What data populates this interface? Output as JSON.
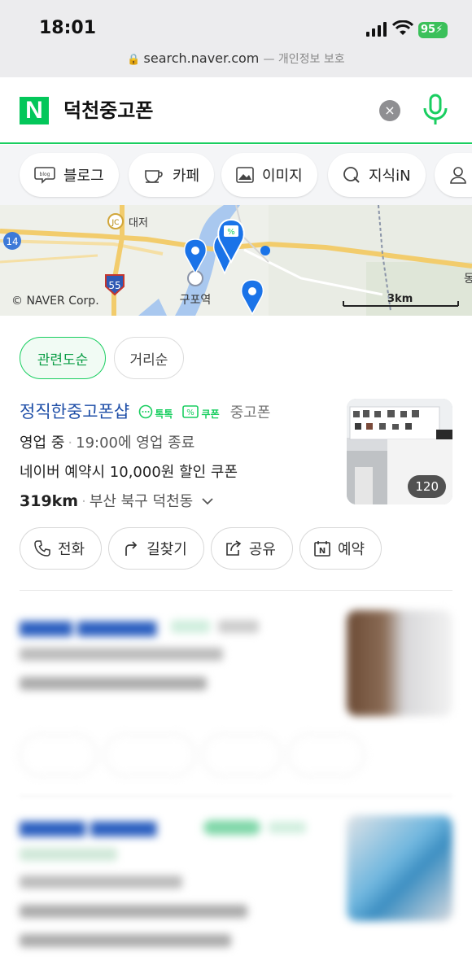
{
  "status_bar": {
    "time": "18:01",
    "battery": "95"
  },
  "address_bar": {
    "domain": "search.naver.com",
    "suffix": "— 개인정보 보호"
  },
  "search": {
    "logo": "N",
    "query": "덕천중고폰"
  },
  "categories": [
    {
      "label": "블로그",
      "icon": "blog-icon"
    },
    {
      "label": "카페",
      "icon": "cafe-cup-icon"
    },
    {
      "label": "이미지",
      "icon": "image-icon"
    },
    {
      "label": "지식iN",
      "icon": "kin-icon"
    },
    {
      "label": "",
      "icon": "person-icon"
    }
  ],
  "map": {
    "copyright": "© NAVER Corp.",
    "scale": "3km",
    "labels": {
      "jc": "JC",
      "daejeo": "대저",
      "gupo": "구포역",
      "route14": "14",
      "route55": "55",
      "edge": "동"
    }
  },
  "sort": {
    "active": "관련도순",
    "other": "거리순"
  },
  "results": [
    {
      "name": "정직한중고폰샵",
      "talk_tag": "톡톡",
      "coupon_tag": "쿠폰",
      "category": "중고폰",
      "status": "영업 중",
      "hours": "19:00에 영업 종료",
      "promo": "네이버 예약시 10,000원 할인 쿠폰",
      "distance": "319km",
      "address": "부산 북구 덕천동",
      "photo_count": "120",
      "actions": [
        "전화",
        "길찾기",
        "공유",
        "예약"
      ]
    }
  ],
  "colors": {
    "naver_green": "#03c75a",
    "link_blue": "#1f4fa8",
    "pin_blue": "#1a73e8"
  }
}
